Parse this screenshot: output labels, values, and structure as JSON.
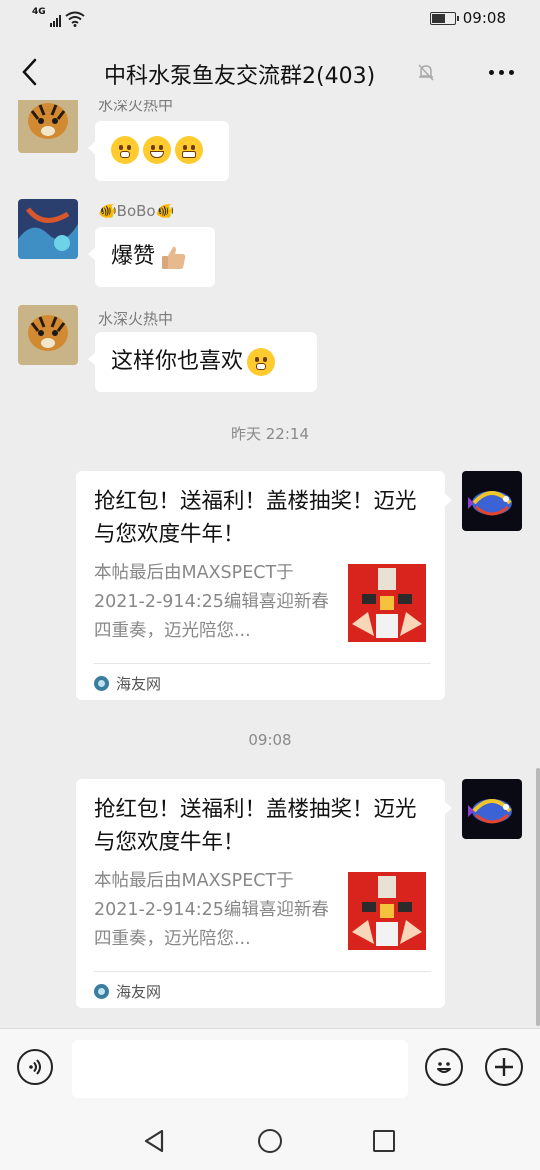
{
  "status_bar": {
    "network": "4G",
    "time": "09:08"
  },
  "header": {
    "title": "中科水泵鱼友交流群2(403)",
    "mute_icon": "bell-muted-icon",
    "more_icon": "more-icon"
  },
  "messages": [
    {
      "sender": "水深火热中",
      "emojis": [
        "thinking-face",
        "grinning-squint-face",
        "grimacing-face"
      ]
    },
    {
      "sender": "🐠BoBo🐠",
      "text": "爆赞",
      "emoji": "thumbs-up"
    },
    {
      "sender": "水深火热中",
      "text": "这样你也喜欢",
      "emoji": "thinking-face"
    }
  ],
  "timestamps": [
    "昨天 22:14",
    "09:08"
  ],
  "cards": [
    {
      "title": "抢红包！送福利！盖楼抽奖！迈光与您欢度牛年！",
      "description": "本帖最后由MAXSPECT于2021-2-914:25编辑喜迎新春四重奏，迈光陪您...",
      "source": "海友网"
    },
    {
      "title": "抢红包！送福利！盖楼抽奖！迈光与您欢度牛年！",
      "description": "本帖最后由MAXSPECT于2021-2-914:25编辑喜迎新春四重奏，迈光陪您...",
      "source": "海友网"
    }
  ],
  "input_bar": {
    "voice_icon": "voice-icon",
    "text_value": "",
    "emoji_icon": "emoji-icon",
    "plus_icon": "plus-icon"
  },
  "colors": {
    "background": "#ededed",
    "bubble": "#ffffff",
    "card_thumb": "#d9231d"
  }
}
